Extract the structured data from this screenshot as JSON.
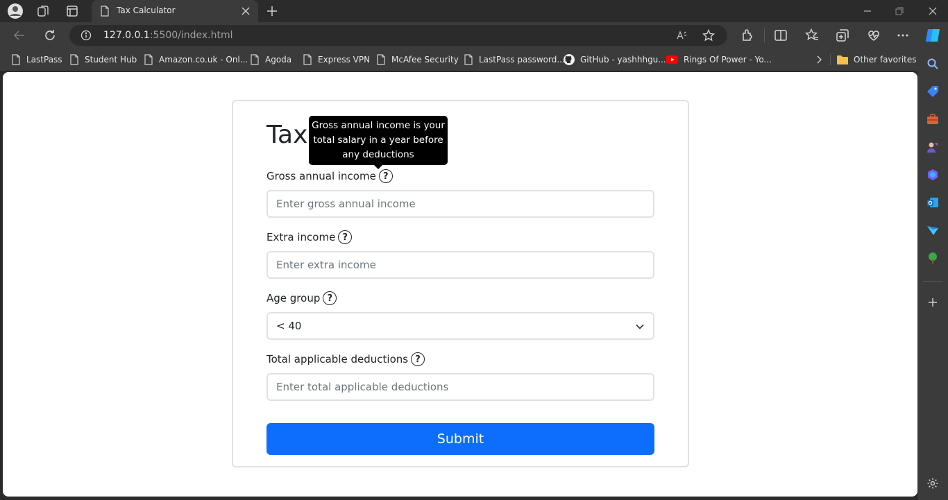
{
  "browser": {
    "tab": {
      "title": "Tax Calculator"
    },
    "address": {
      "host": "127.0.0.1",
      "rest": ":5500/index.html"
    },
    "favorites": [
      {
        "label": "LastPass",
        "icon": "page-icon"
      },
      {
        "label": "Student Hub",
        "icon": "page-icon"
      },
      {
        "label": "Amazon.co.uk - Onl...",
        "icon": "page-icon"
      },
      {
        "label": "Agoda",
        "icon": "page-icon"
      },
      {
        "label": "Express VPN",
        "icon": "page-icon"
      },
      {
        "label": "McAfee Security",
        "icon": "page-icon"
      },
      {
        "label": "LastPass password...",
        "icon": "page-icon"
      },
      {
        "label": "GitHub - yashhhgu...",
        "icon": "github-icon"
      },
      {
        "label": "Rings Of Power - Yo...",
        "icon": "youtube-icon"
      }
    ],
    "other_favorites": "Other favorites"
  },
  "page": {
    "title": "Tax",
    "tooltip": {
      "line1": "Gross annual income is your",
      "line2": "total salary in a year before",
      "line3": "any deductions"
    },
    "fields": {
      "gross": {
        "label": "Gross annual income",
        "placeholder": "Enter gross annual income"
      },
      "extra": {
        "label": "Extra income",
        "placeholder": "Enter extra income"
      },
      "age": {
        "label": "Age group",
        "value": "< 40"
      },
      "deductions": {
        "label": "Total applicable deductions",
        "placeholder": "Enter total applicable deductions"
      }
    },
    "help_symbol": "?",
    "submit_label": "Submit"
  },
  "colors": {
    "primary": "#0d6efd",
    "tooltip_bg": "#000000",
    "border": "#dee2e6"
  }
}
